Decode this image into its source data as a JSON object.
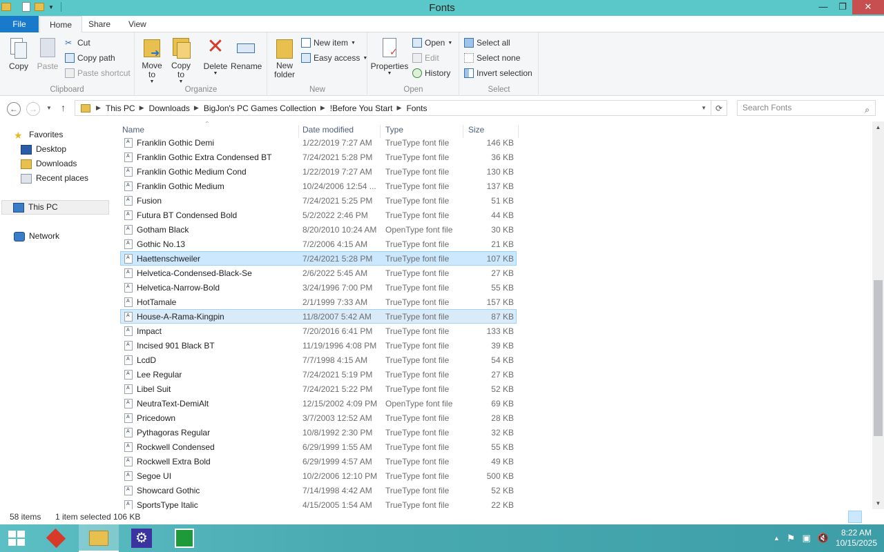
{
  "window": {
    "title": "Fonts"
  },
  "titlebar_buttons": {
    "minimize": "—",
    "maximize": "❐",
    "close": "✕"
  },
  "ribbon_tabs": {
    "file": "File",
    "home": "Home",
    "share": "Share",
    "view": "View"
  },
  "ribbon": {
    "clipboard": {
      "label": "Clipboard",
      "copy": "Copy",
      "paste": "Paste",
      "cut": "Cut",
      "copy_path": "Copy path",
      "paste_shortcut": "Paste shortcut"
    },
    "organize": {
      "label": "Organize",
      "move_to": "Move to",
      "copy_to": "Copy to",
      "delete": "Delete",
      "rename": "Rename"
    },
    "new": {
      "label": "New",
      "new_folder": "New folder",
      "new_item": "New item",
      "easy_access": "Easy access"
    },
    "open": {
      "label": "Open",
      "properties": "Properties",
      "open": "Open",
      "edit": "Edit",
      "history": "History"
    },
    "select": {
      "label": "Select",
      "select_all": "Select all",
      "select_none": "Select none",
      "invert_selection": "Invert selection"
    }
  },
  "address": {
    "crumbs": [
      "This PC",
      "Downloads",
      "BigJon's PC Games Collection",
      "!Before You Start",
      "Fonts"
    ],
    "search_placeholder": "Search Fonts"
  },
  "navpane": {
    "favorites": "Favorites",
    "desktop": "Desktop",
    "downloads": "Downloads",
    "recent": "Recent places",
    "this_pc": "This PC",
    "network": "Network"
  },
  "columns": {
    "name": "Name",
    "date": "Date modified",
    "type": "Type",
    "size": "Size"
  },
  "files": [
    {
      "name": "Franklin Gothic Demi",
      "date": "1/22/2019 7:27 AM",
      "type": "TrueType font file",
      "size": "146 KB",
      "sel": ""
    },
    {
      "name": "Franklin Gothic Extra Condensed BT",
      "date": "7/24/2021 5:28 PM",
      "type": "TrueType font file",
      "size": "36 KB",
      "sel": ""
    },
    {
      "name": "Franklin Gothic Medium Cond",
      "date": "1/22/2019 7:27 AM",
      "type": "TrueType font file",
      "size": "130 KB",
      "sel": ""
    },
    {
      "name": "Franklin Gothic Medium",
      "date": "10/24/2006 12:54 ...",
      "type": "TrueType font file",
      "size": "137 KB",
      "sel": ""
    },
    {
      "name": "Fusion",
      "date": "7/24/2021 5:25 PM",
      "type": "TrueType font file",
      "size": "51 KB",
      "sel": ""
    },
    {
      "name": "Futura BT Condensed Bold",
      "date": "5/2/2022 2:46 PM",
      "type": "TrueType font file",
      "size": "44 KB",
      "sel": ""
    },
    {
      "name": "Gotham Black",
      "date": "8/20/2010 10:24 AM",
      "type": "OpenType font file",
      "size": "30 KB",
      "sel": ""
    },
    {
      "name": "Gothic No.13",
      "date": "7/2/2006 4:15 AM",
      "type": "TrueType font file",
      "size": "21 KB",
      "sel": ""
    },
    {
      "name": "Haettenschweiler",
      "date": "7/24/2021 5:28 PM",
      "type": "TrueType font file",
      "size": "107 KB",
      "sel": "sel"
    },
    {
      "name": "Helvetica-Condensed-Black-Se",
      "date": "2/6/2022 5:45 AM",
      "type": "TrueType font file",
      "size": "27 KB",
      "sel": ""
    },
    {
      "name": "Helvetica-Narrow-Bold",
      "date": "3/24/1996 7:00 PM",
      "type": "TrueType font file",
      "size": "55 KB",
      "sel": ""
    },
    {
      "name": "HotTamale",
      "date": "2/1/1999 7:33 AM",
      "type": "TrueType font file",
      "size": "157 KB",
      "sel": ""
    },
    {
      "name": "House-A-Rama-Kingpin",
      "date": "11/8/2007 5:42 AM",
      "type": "TrueType font file",
      "size": "87 KB",
      "sel": "sel2"
    },
    {
      "name": "Impact",
      "date": "7/20/2016 6:41 PM",
      "type": "TrueType font file",
      "size": "133 KB",
      "sel": ""
    },
    {
      "name": "Incised 901 Black BT",
      "date": "11/19/1996 4:08 PM",
      "type": "TrueType font file",
      "size": "39 KB",
      "sel": ""
    },
    {
      "name": "LcdD",
      "date": "7/7/1998 4:15 AM",
      "type": "TrueType font file",
      "size": "54 KB",
      "sel": ""
    },
    {
      "name": "Lee Regular",
      "date": "7/24/2021 5:19 PM",
      "type": "TrueType font file",
      "size": "27 KB",
      "sel": ""
    },
    {
      "name": "Libel Suit",
      "date": "7/24/2021 5:22 PM",
      "type": "TrueType font file",
      "size": "52 KB",
      "sel": ""
    },
    {
      "name": "NeutraText-DemiAlt",
      "date": "12/15/2002 4:09 PM",
      "type": "OpenType font file",
      "size": "69 KB",
      "sel": ""
    },
    {
      "name": "Pricedown",
      "date": "3/7/2003 12:52 AM",
      "type": "TrueType font file",
      "size": "28 KB",
      "sel": ""
    },
    {
      "name": "Pythagoras Regular",
      "date": "10/8/1992 2:30 PM",
      "type": "TrueType font file",
      "size": "32 KB",
      "sel": ""
    },
    {
      "name": "Rockwell Condensed",
      "date": "6/29/1999 1:55 AM",
      "type": "TrueType font file",
      "size": "55 KB",
      "sel": ""
    },
    {
      "name": "Rockwell Extra Bold",
      "date": "6/29/1999 4:57 AM",
      "type": "TrueType font file",
      "size": "49 KB",
      "sel": ""
    },
    {
      "name": "Segoe UI",
      "date": "10/2/2006 12:10 PM",
      "type": "TrueType font file",
      "size": "500 KB",
      "sel": ""
    },
    {
      "name": "Showcard Gothic",
      "date": "7/14/1998 4:42 AM",
      "type": "TrueType font file",
      "size": "52 KB",
      "sel": ""
    },
    {
      "name": "SportsType Italic",
      "date": "4/15/2005 1:54 AM",
      "type": "TrueType font file",
      "size": "22 KB",
      "sel": ""
    }
  ],
  "status": {
    "items": "58 items",
    "selected": "1 item selected",
    "size": "106 KB"
  },
  "tray": {
    "time": "8:22 AM",
    "date": "10/15/2025"
  },
  "colors": {
    "titlebar": "#5ac8c9",
    "file_tab": "#1979ca",
    "selection": "#cce8ff"
  }
}
